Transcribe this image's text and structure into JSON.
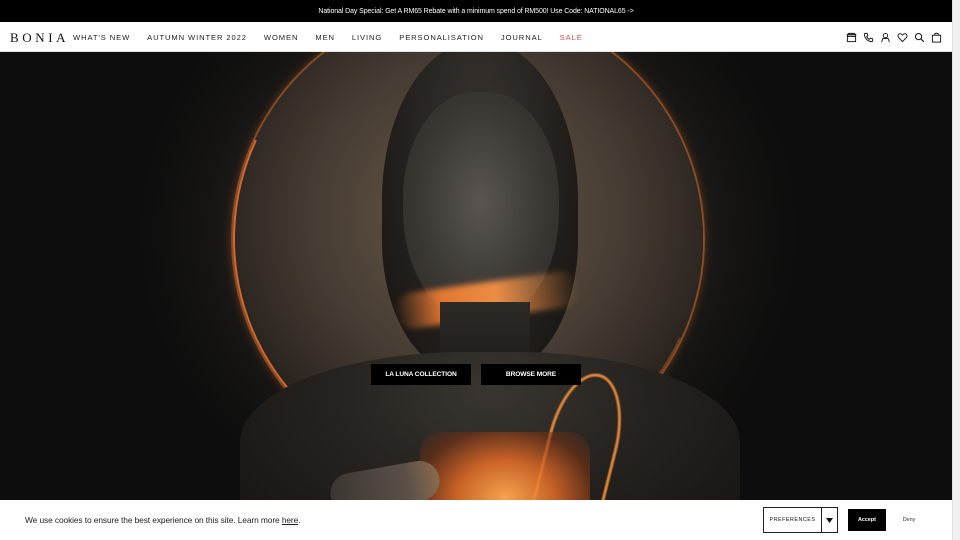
{
  "promo": {
    "text": "National Day Special: Get A RM65 Rebate with a minimum spend of RM500! Use Code: NATIONAL65 ->"
  },
  "header": {
    "logo": "BONIA",
    "nav": [
      {
        "label": "WHAT'S NEW"
      },
      {
        "label": "AUTUMN WINTER 2022"
      },
      {
        "label": "WOMEN"
      },
      {
        "label": "MEN"
      },
      {
        "label": "LIVING"
      },
      {
        "label": "PERSONALISATION"
      },
      {
        "label": "JOURNAL"
      },
      {
        "label": "SALE"
      }
    ],
    "icons": [
      "store-icon",
      "phone-icon",
      "account-icon",
      "wishlist-heart-icon",
      "search-icon",
      "shopping-bag-icon"
    ],
    "sale_color": "#e0494f"
  },
  "hero": {
    "buttons": [
      {
        "label": "LA LUNA COLLECTION"
      },
      {
        "label": "BROWSE MORE"
      }
    ]
  },
  "cookie": {
    "text": "We use cookies to ensure the best experience on this site. Learn more ",
    "link": "here",
    "suffix": ".",
    "preferences": "PREFERENCES",
    "accept": "Accept",
    "deny": "Deny"
  }
}
